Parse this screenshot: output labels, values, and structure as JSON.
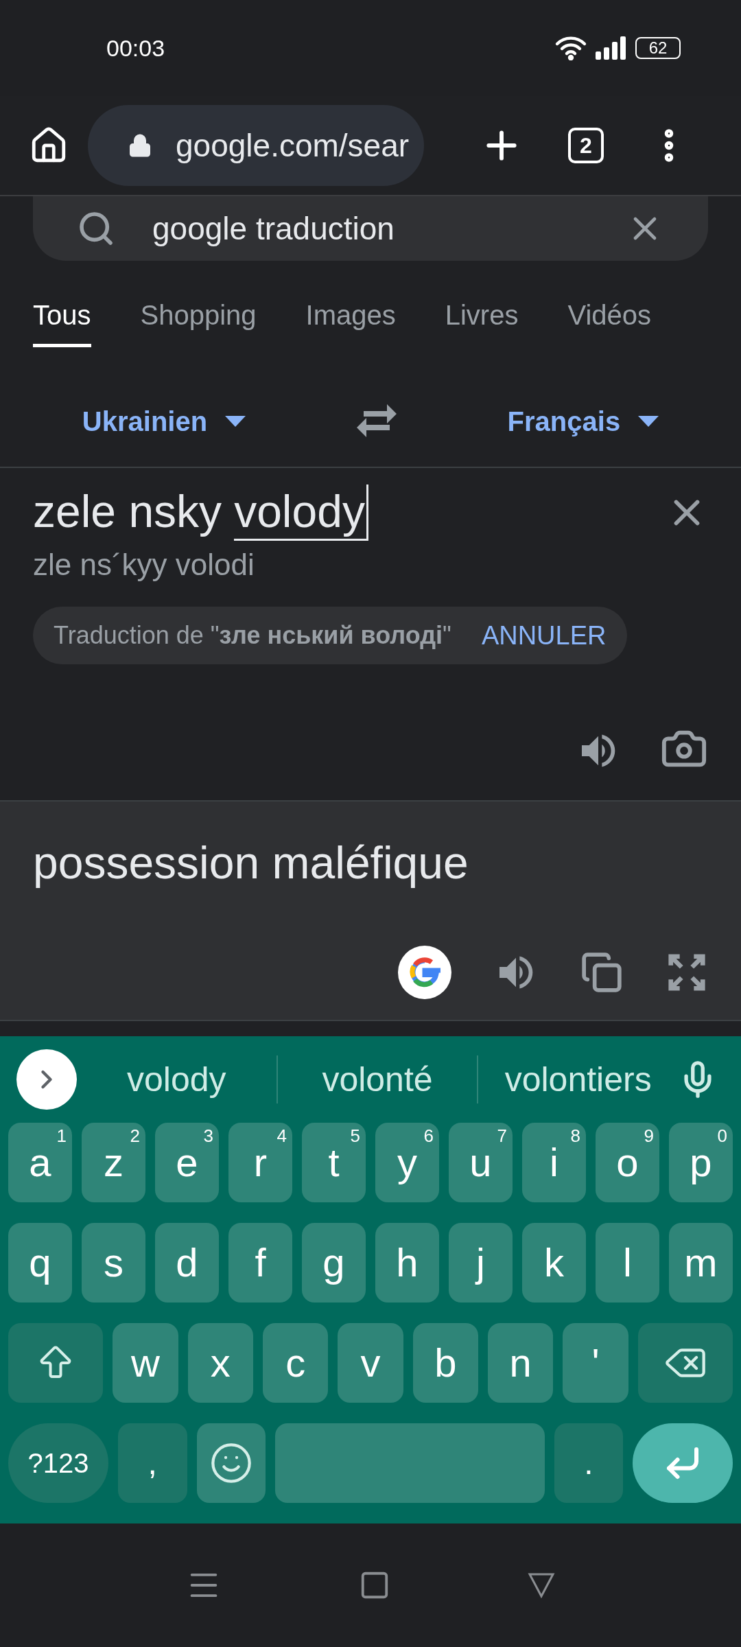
{
  "status_bar": {
    "time": "00:03",
    "battery": "62"
  },
  "toolbar": {
    "url": "google.com/sear",
    "tab_count": "2"
  },
  "search": {
    "value": "google traduction"
  },
  "tabs": [
    {
      "label": "Tous",
      "selected": true
    },
    {
      "label": "Shopping",
      "selected": false
    },
    {
      "label": "Images",
      "selected": false
    },
    {
      "label": "Livres",
      "selected": false
    },
    {
      "label": "Vidéos",
      "selected": false
    }
  ],
  "languages": {
    "source": "Ukrainien",
    "target": "Français"
  },
  "input": {
    "committed": "zele nsky",
    "composing": "volody",
    "transliteration": "zle ns´kyy volodi"
  },
  "detected": {
    "text": "Traduction de \"**зле нський володі**\"",
    "action": "ANNULER"
  },
  "output": {
    "text": "possession maléfique"
  },
  "keyboard": {
    "suggestions": [
      "volody",
      "volonté",
      "volontiers"
    ],
    "rows": [
      [
        {
          "kind": "letter",
          "label": "a",
          "hint": "1"
        },
        {
          "kind": "letter",
          "label": "z",
          "hint": "2"
        },
        {
          "kind": "letter",
          "label": "e",
          "hint": "3"
        },
        {
          "kind": "letter",
          "label": "r",
          "hint": "4"
        },
        {
          "kind": "letter",
          "label": "t",
          "hint": "5"
        },
        {
          "kind": "letter",
          "label": "y",
          "hint": "6"
        },
        {
          "kind": "letter",
          "label": "u",
          "hint": "7"
        },
        {
          "kind": "letter",
          "label": "i",
          "hint": "8"
        },
        {
          "kind": "letter",
          "label": "o",
          "hint": "9"
        },
        {
          "kind": "letter",
          "label": "p",
          "hint": "0"
        }
      ],
      [
        {
          "kind": "letter",
          "label": "q"
        },
        {
          "kind": "letter",
          "label": "s"
        },
        {
          "kind": "letter",
          "label": "d"
        },
        {
          "kind": "letter",
          "label": "f"
        },
        {
          "kind": "letter",
          "label": "g"
        },
        {
          "kind": "letter",
          "label": "h"
        },
        {
          "kind": "letter",
          "label": "j"
        },
        {
          "kind": "letter",
          "label": "k"
        },
        {
          "kind": "letter",
          "label": "l"
        },
        {
          "kind": "letter",
          "label": "m"
        }
      ],
      [
        {
          "kind": "shift"
        },
        {
          "kind": "letter",
          "label": "w"
        },
        {
          "kind": "letter",
          "label": "x"
        },
        {
          "kind": "letter",
          "label": "c"
        },
        {
          "kind": "letter",
          "label": "v"
        },
        {
          "kind": "letter",
          "label": "b"
        },
        {
          "kind": "letter",
          "label": "n"
        },
        {
          "kind": "letter",
          "label": "'"
        },
        {
          "kind": "backspace"
        }
      ],
      [
        {
          "kind": "symbols",
          "label": "?123"
        },
        {
          "kind": "punct",
          "label": ","
        },
        {
          "kind": "emoji"
        },
        {
          "kind": "space"
        },
        {
          "kind": "punct",
          "label": "."
        },
        {
          "kind": "enter"
        }
      ]
    ]
  }
}
